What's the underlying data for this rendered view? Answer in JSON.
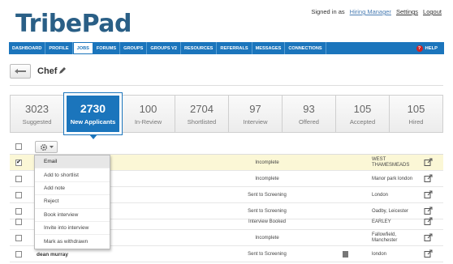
{
  "brand": {
    "logo": "TribePad"
  },
  "topbar": {
    "signed_in_label": "Signed in as",
    "user": "Hiring Manager",
    "settings": "Settings",
    "logout": "Logout"
  },
  "nav": {
    "items": [
      "DASHBOARD",
      "PROFILE",
      "JOBS",
      "FORUMS",
      "GROUPS",
      "GROUPS V2",
      "RESOURCES",
      "REFERRALS",
      "MESSAGES",
      "CONNECTIONS"
    ],
    "active": "JOBS",
    "help": "HELP",
    "help_badge": "?"
  },
  "job": {
    "title": "Chef"
  },
  "stats": [
    {
      "num": "3023",
      "label": "Suggested"
    },
    {
      "num": "2730",
      "label": "New Applicants"
    },
    {
      "num": "100",
      "label": "In-Review"
    },
    {
      "num": "2704",
      "label": "Shortlisted"
    },
    {
      "num": "97",
      "label": "Interview"
    },
    {
      "num": "93",
      "label": "Offered"
    },
    {
      "num": "105",
      "label": "Accepted"
    },
    {
      "num": "105",
      "label": "Hired"
    }
  ],
  "rows": [
    {
      "name": "",
      "status": "Incomplete",
      "location": [
        "WEST",
        "THAMESMEADS"
      ],
      "checked": "✔"
    },
    {
      "name": "",
      "status": "Incomplete",
      "location": [
        "Manor park london"
      ],
      "checked": ""
    },
    {
      "name": "",
      "status": "Sent to Screening",
      "location": [
        "London"
      ],
      "checked": ""
    },
    {
      "name": "",
      "status": "Sent to Screening",
      "location": [
        "Oadby, Leicester"
      ],
      "checked": ""
    },
    {
      "name": "",
      "status": "Interview Booked",
      "location": [
        "EARLEY"
      ],
      "checked": ""
    },
    {
      "name": "",
      "status": "Incomplete",
      "location": [
        "Fallowfield,",
        "Manchester"
      ],
      "checked": ""
    },
    {
      "name": "dean murray",
      "status": "Sent to Screening",
      "location": [
        "london"
      ],
      "checked": ""
    }
  ],
  "actions_menu": [
    "Email",
    "Add to shortlist",
    "Add note",
    "Reject",
    "Book interview",
    "Invite into interview",
    "Mark as withdrawn"
  ],
  "colors": {
    "nav": "#1b75bc",
    "logo": "#2a5f86",
    "selected_row": "#fbf7d6"
  }
}
